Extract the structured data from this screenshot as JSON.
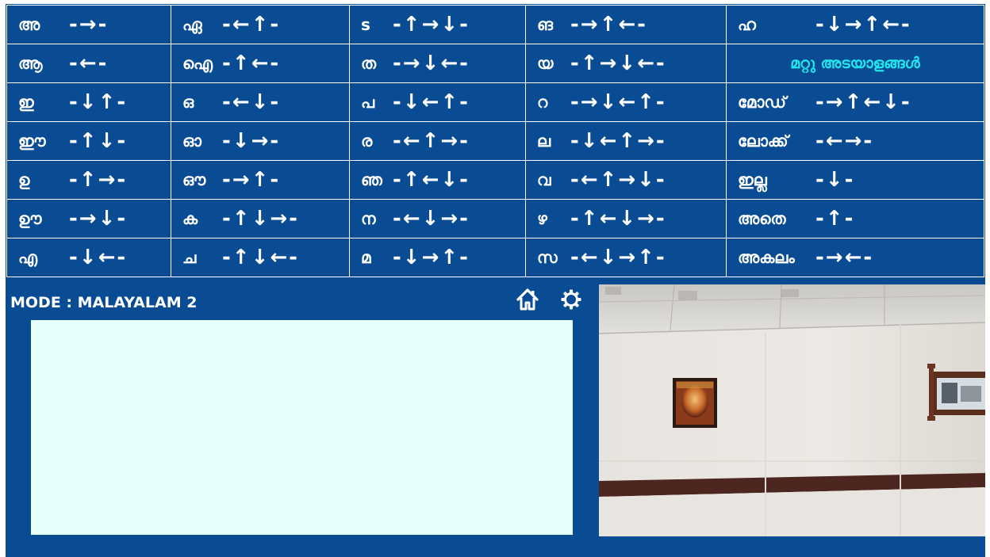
{
  "keyboard": {
    "rows": [
      [
        {
          "char": "അ",
          "seq": "-→-"
        },
        {
          "char": "ഏ",
          "seq": "-←↑-"
        },
        {
          "char": "s",
          "seq": "-↑→↓-"
        },
        {
          "char": "ങ",
          "seq": "-→↑←-"
        },
        {
          "char": "ഹ",
          "seq": "-↓→↑←-"
        }
      ],
      [
        {
          "char": "ആ",
          "seq": "-←-"
        },
        {
          "char": "ഐ",
          "seq": "-↑←-"
        },
        {
          "char": "ത",
          "seq": "-→↓←-"
        },
        {
          "char": "യ",
          "seq": "-↑→↓←-"
        },
        {
          "char": "മറ്റു അടയാളങ്ങൾ",
          "seq": ""
        }
      ],
      [
        {
          "char": "ഇ",
          "seq": "-↓↑-"
        },
        {
          "char": "ഒ",
          "seq": "-←↓-"
        },
        {
          "char": "പ",
          "seq": "-↓←↑-"
        },
        {
          "char": "റ",
          "seq": "-→↓←↑-"
        },
        {
          "char": "മോഡ്",
          "seq": "-→↑←↓-"
        }
      ],
      [
        {
          "char": "ഈ",
          "seq": "-↑↓-"
        },
        {
          "char": "ഓ",
          "seq": "-↓→-"
        },
        {
          "char": "ര",
          "seq": "-←↑→-"
        },
        {
          "char": "ല",
          "seq": "-↓←↑→-"
        },
        {
          "char": "ലോക്ക്",
          "seq": "-←→-"
        }
      ],
      [
        {
          "char": "ഉ",
          "seq": "-↑→-"
        },
        {
          "char": "ഔ",
          "seq": "-→↑-"
        },
        {
          "char": "ഞ",
          "seq": "-↑←↓-"
        },
        {
          "char": "വ",
          "seq": "-←↑→↓-"
        },
        {
          "char": "ഇല്ല",
          "seq": "-↓-"
        }
      ],
      [
        {
          "char": "ഊ",
          "seq": "-→↓-"
        },
        {
          "char": "ക",
          "seq": "-↑↓→-"
        },
        {
          "char": "ന",
          "seq": "-←↓→-"
        },
        {
          "char": "ഴ",
          "seq": "-↑←↓→-"
        },
        {
          "char": "അതെ",
          "seq": "-↑-"
        }
      ],
      [
        {
          "char": "എ",
          "seq": "-↓←-"
        },
        {
          "char": "ച",
          "seq": "-↑↓←-"
        },
        {
          "char": "മ",
          "seq": "-↓→↑-"
        },
        {
          "char": "സ",
          "seq": "-←↓→↑-"
        },
        {
          "char": "അകലം",
          "seq": "-→←-"
        }
      ]
    ]
  },
  "mode_label": "MODE : MALAYALAM 2",
  "output_text": "",
  "icons": {
    "home": "home-icon",
    "settings": "gear-icon"
  },
  "colors": {
    "background": "#0a4c93",
    "special_text": "#22e6ee",
    "text_area": "#e6fffd"
  }
}
